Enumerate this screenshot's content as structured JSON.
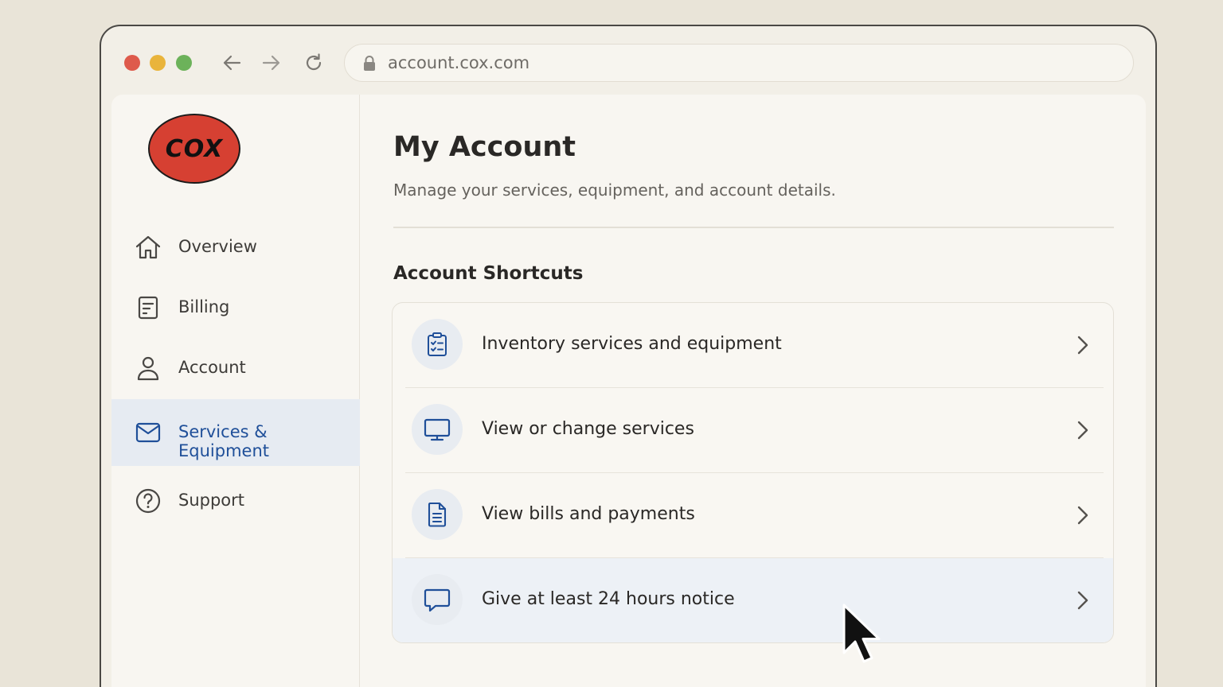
{
  "browser": {
    "url": "account.cox.com"
  },
  "logo": {
    "text": "COX"
  },
  "sidebar": {
    "items": [
      {
        "label": "Overview",
        "icon": "home-icon"
      },
      {
        "label": "Billing",
        "icon": "billing-icon"
      },
      {
        "label": "Account",
        "icon": "user-icon"
      },
      {
        "label": "Services & Equipment",
        "icon": "mail-icon",
        "active": true
      },
      {
        "label": "Support",
        "icon": "help-icon"
      }
    ]
  },
  "main": {
    "title": "My Account",
    "subtitle": "Manage your services, equipment, and account details.",
    "section_title": "Account Shortcuts",
    "shortcuts": [
      {
        "label": "Inventory services and equipment",
        "icon": "clipboard-checklist-icon"
      },
      {
        "label": "View or change services",
        "icon": "monitor-icon"
      },
      {
        "label": "View bills and payments",
        "icon": "document-icon"
      },
      {
        "label": "Give at least 24 hours notice",
        "icon": "chat-bubble-icon",
        "hovered": true
      }
    ]
  },
  "colors": {
    "accent": "#1f4f99",
    "logo_red": "#d64032",
    "active_bg": "#e6ebf2"
  }
}
